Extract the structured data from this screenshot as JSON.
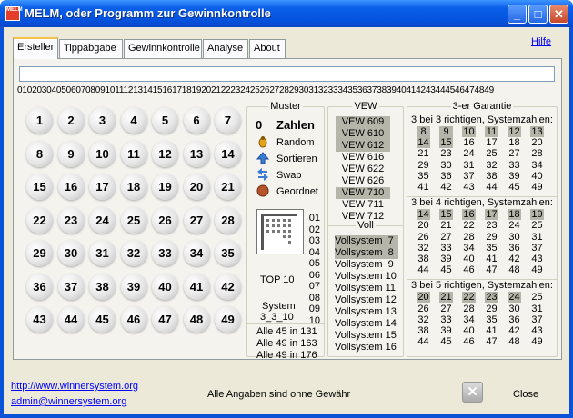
{
  "window": {
    "title": "MELM, oder Programm zur Gewinnkontrolle",
    "app_icon": "MELM",
    "minimize": "_",
    "maximize": "□",
    "close": "✕"
  },
  "tabs": [
    "Erstellen",
    "Tippabgabe",
    "Gewinnkontrolle",
    "Analyse",
    "About"
  ],
  "help": "Hilfe",
  "number_line": "01020304050607080910111213141516171819202122232425262728293031323334353637383940414243444546474849",
  "balls": [
    "1",
    "2",
    "3",
    "4",
    "5",
    "6",
    "7",
    "8",
    "9",
    "10",
    "11",
    "12",
    "13",
    "14",
    "15",
    "16",
    "17",
    "18",
    "19",
    "20",
    "21",
    "22",
    "23",
    "24",
    "25",
    "26",
    "27",
    "28",
    "29",
    "30",
    "31",
    "32",
    "33",
    "34",
    "35",
    "36",
    "37",
    "38",
    "39",
    "40",
    "41",
    "42",
    "43",
    "44",
    "45",
    "46",
    "47",
    "48",
    "49"
  ],
  "muster": {
    "title": "Muster",
    "count": "0",
    "zahlen": "Zahlen",
    "random": "Random",
    "sortieren": "Sortieren",
    "swap": "Swap",
    "geordnet": "Geordnet",
    "list": [
      "01",
      "02",
      "03",
      "04",
      "05",
      "06",
      "07",
      "08",
      "09",
      "10"
    ],
    "top10": "TOP 10",
    "system": "System",
    "system_name": "3_3_10",
    "alle": [
      "Alle 45 in 131",
      "Alle 49 in 163",
      "Alle 49 in 176"
    ]
  },
  "vew": {
    "title": "VEW",
    "items": [
      {
        "label": "VEW 609",
        "hl": true
      },
      {
        "label": "VEW 610",
        "hl": true
      },
      {
        "label": "VEW 612",
        "hl": true
      },
      {
        "label": "VEW 616",
        "hl": false
      },
      {
        "label": "VEW 622",
        "hl": false
      },
      {
        "label": "VEW 626",
        "hl": false
      },
      {
        "label": "VEW 710",
        "hl": true
      },
      {
        "label": "VEW 711",
        "hl": false
      },
      {
        "label": "VEW 712",
        "hl": false
      }
    ]
  },
  "voll": {
    "title": "Voll",
    "items": [
      {
        "label": "Vollsystem  7",
        "hl": true
      },
      {
        "label": "Vollsystem  8",
        "hl": true
      },
      {
        "label": "Vollsystem  9",
        "hl": false
      },
      {
        "label": "Vollsystem 10",
        "hl": false
      },
      {
        "label": "Vollsystem 11",
        "hl": false
      },
      {
        "label": "Vollsystem 12",
        "hl": false
      },
      {
        "label": "Vollsystem 13",
        "hl": false
      },
      {
        "label": "Vollsystem 14",
        "hl": false
      },
      {
        "label": "Vollsystem 15",
        "hl": false
      },
      {
        "label": "Vollsystem 16",
        "hl": false
      }
    ]
  },
  "garantie": {
    "title": "3-er Garantie",
    "sections": [
      {
        "header": "3 bei 3 richtigen, Systemzahlen:",
        "rows": [
          [
            "8",
            "9",
            "10",
            "11",
            "12",
            "13"
          ],
          [
            "14",
            "15",
            "16",
            "17",
            "18",
            "20"
          ],
          [
            "21",
            "23",
            "24",
            "25",
            "27",
            "28"
          ],
          [
            "29",
            "30",
            "31",
            "32",
            "33",
            "34"
          ],
          [
            "35",
            "36",
            "37",
            "38",
            "39",
            "40"
          ],
          [
            "41",
            "42",
            "43",
            "44",
            "45",
            "49"
          ]
        ],
        "hl": [
          "8",
          "9",
          "10",
          "11",
          "12",
          "13",
          "14",
          "15"
        ]
      },
      {
        "header": "3 bei 4 richtigen, Systemzahlen:",
        "rows": [
          [
            "14",
            "15",
            "16",
            "17",
            "18",
            "19"
          ],
          [
            "20",
            "21",
            "22",
            "23",
            "24",
            "25"
          ],
          [
            "26",
            "27",
            "28",
            "29",
            "30",
            "31"
          ],
          [
            "32",
            "33",
            "34",
            "35",
            "36",
            "37"
          ],
          [
            "38",
            "39",
            "40",
            "41",
            "42",
            "43"
          ],
          [
            "44",
            "45",
            "46",
            "47",
            "48",
            "49"
          ]
        ],
        "hl": [
          "14",
          "15",
          "16",
          "17",
          "18",
          "19"
        ]
      },
      {
        "header": "3 bei 5 richtigen, Systemzahlen:",
        "rows": [
          [
            "20",
            "21",
            "22",
            "23",
            "24",
            "25"
          ],
          [
            "26",
            "27",
            "28",
            "29",
            "30",
            "31"
          ],
          [
            "32",
            "33",
            "34",
            "35",
            "36",
            "37"
          ],
          [
            "38",
            "39",
            "40",
            "41",
            "42",
            "43"
          ],
          [
            "44",
            "45",
            "46",
            "47",
            "48",
            "49"
          ]
        ],
        "hl": [
          "20",
          "21",
          "22",
          "23",
          "24"
        ]
      }
    ]
  },
  "footer": {
    "url": "http://www.winnersystem.org",
    "email": "admin@winnersystem.org",
    "status": "Alle Angaben sind ohne Gewähr",
    "x": "✕",
    "close": "Close"
  }
}
